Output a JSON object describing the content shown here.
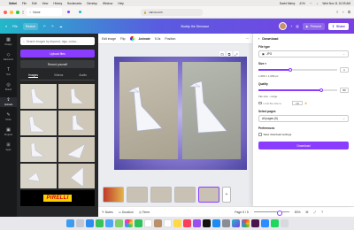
{
  "menubar": {
    "app": "Safari",
    "items": [
      "File",
      "Edit",
      "View",
      "History",
      "Bookmarks",
      "Develop",
      "Window",
      "Help"
    ],
    "user": "David Mainy",
    "battery": "41%",
    "datetime": "Wed Nov 11  10:09 AM"
  },
  "browser": {
    "tab1": "Home",
    "url": "canva.com"
  },
  "topbar": {
    "file": "File",
    "resize": "Resize",
    "title": "Buddy the Dinosaur",
    "present": "Present",
    "share": "Share"
  },
  "rail": [
    {
      "icon": "design-icon",
      "glyph": "▦",
      "label": "Design"
    },
    {
      "icon": "elements-icon",
      "glyph": "◇",
      "label": "Elements"
    },
    {
      "icon": "text-icon",
      "glyph": "T",
      "label": "Text"
    },
    {
      "icon": "brand-icon",
      "glyph": "◎",
      "label": "Brand"
    },
    {
      "icon": "uploads-icon",
      "glyph": "⇪",
      "label": "Uploads"
    },
    {
      "icon": "draw-icon",
      "glyph": "✎",
      "label": "Draw"
    },
    {
      "icon": "projects-icon",
      "glyph": "▣",
      "label": "Projects"
    },
    {
      "icon": "apps-icon",
      "glyph": "⊞",
      "label": "Apps"
    }
  ],
  "panel": {
    "search_placeholder": "Search images by keyword, tags, colour...",
    "upload": "Upload files",
    "record": "Record yourself",
    "tabs": [
      "Images",
      "Videos",
      "Audio"
    ],
    "brand_logo": "PIRELLI"
  },
  "editor": {
    "edit_image": "Edit image",
    "flip": "Flip",
    "animate": "Animate",
    "duration": "5.0s",
    "position": "Position"
  },
  "bottom": {
    "notes": "Notes",
    "duration": "Duration",
    "timer": "Timer",
    "pages": "Page 5 / 5",
    "zoom": "50%",
    "zoom_level": 0.5
  },
  "download": {
    "back": "‹",
    "title": "Download",
    "file_type_label": "File type",
    "file_type": "JPG",
    "size_label": "Size ×",
    "size_value": "1",
    "size_fraction": 0.4,
    "dimensions": "1,080 × 1,080 px",
    "quality_label": "Quality",
    "quality_value": "80",
    "quality_fraction": 0.8,
    "file_size_label": "File size - Large",
    "limit_label": "Limit file size to",
    "limit_value": "KB",
    "pages_label": "Select pages",
    "pages_value": "All pages (5)",
    "prefs_label": "Preferences",
    "save_settings": "Save download settings",
    "download_btn": "Download"
  },
  "colors": {
    "accent": "#8b3dff",
    "topbar_start": "#22b8c9",
    "topbar_end": "#7b3fe4"
  }
}
